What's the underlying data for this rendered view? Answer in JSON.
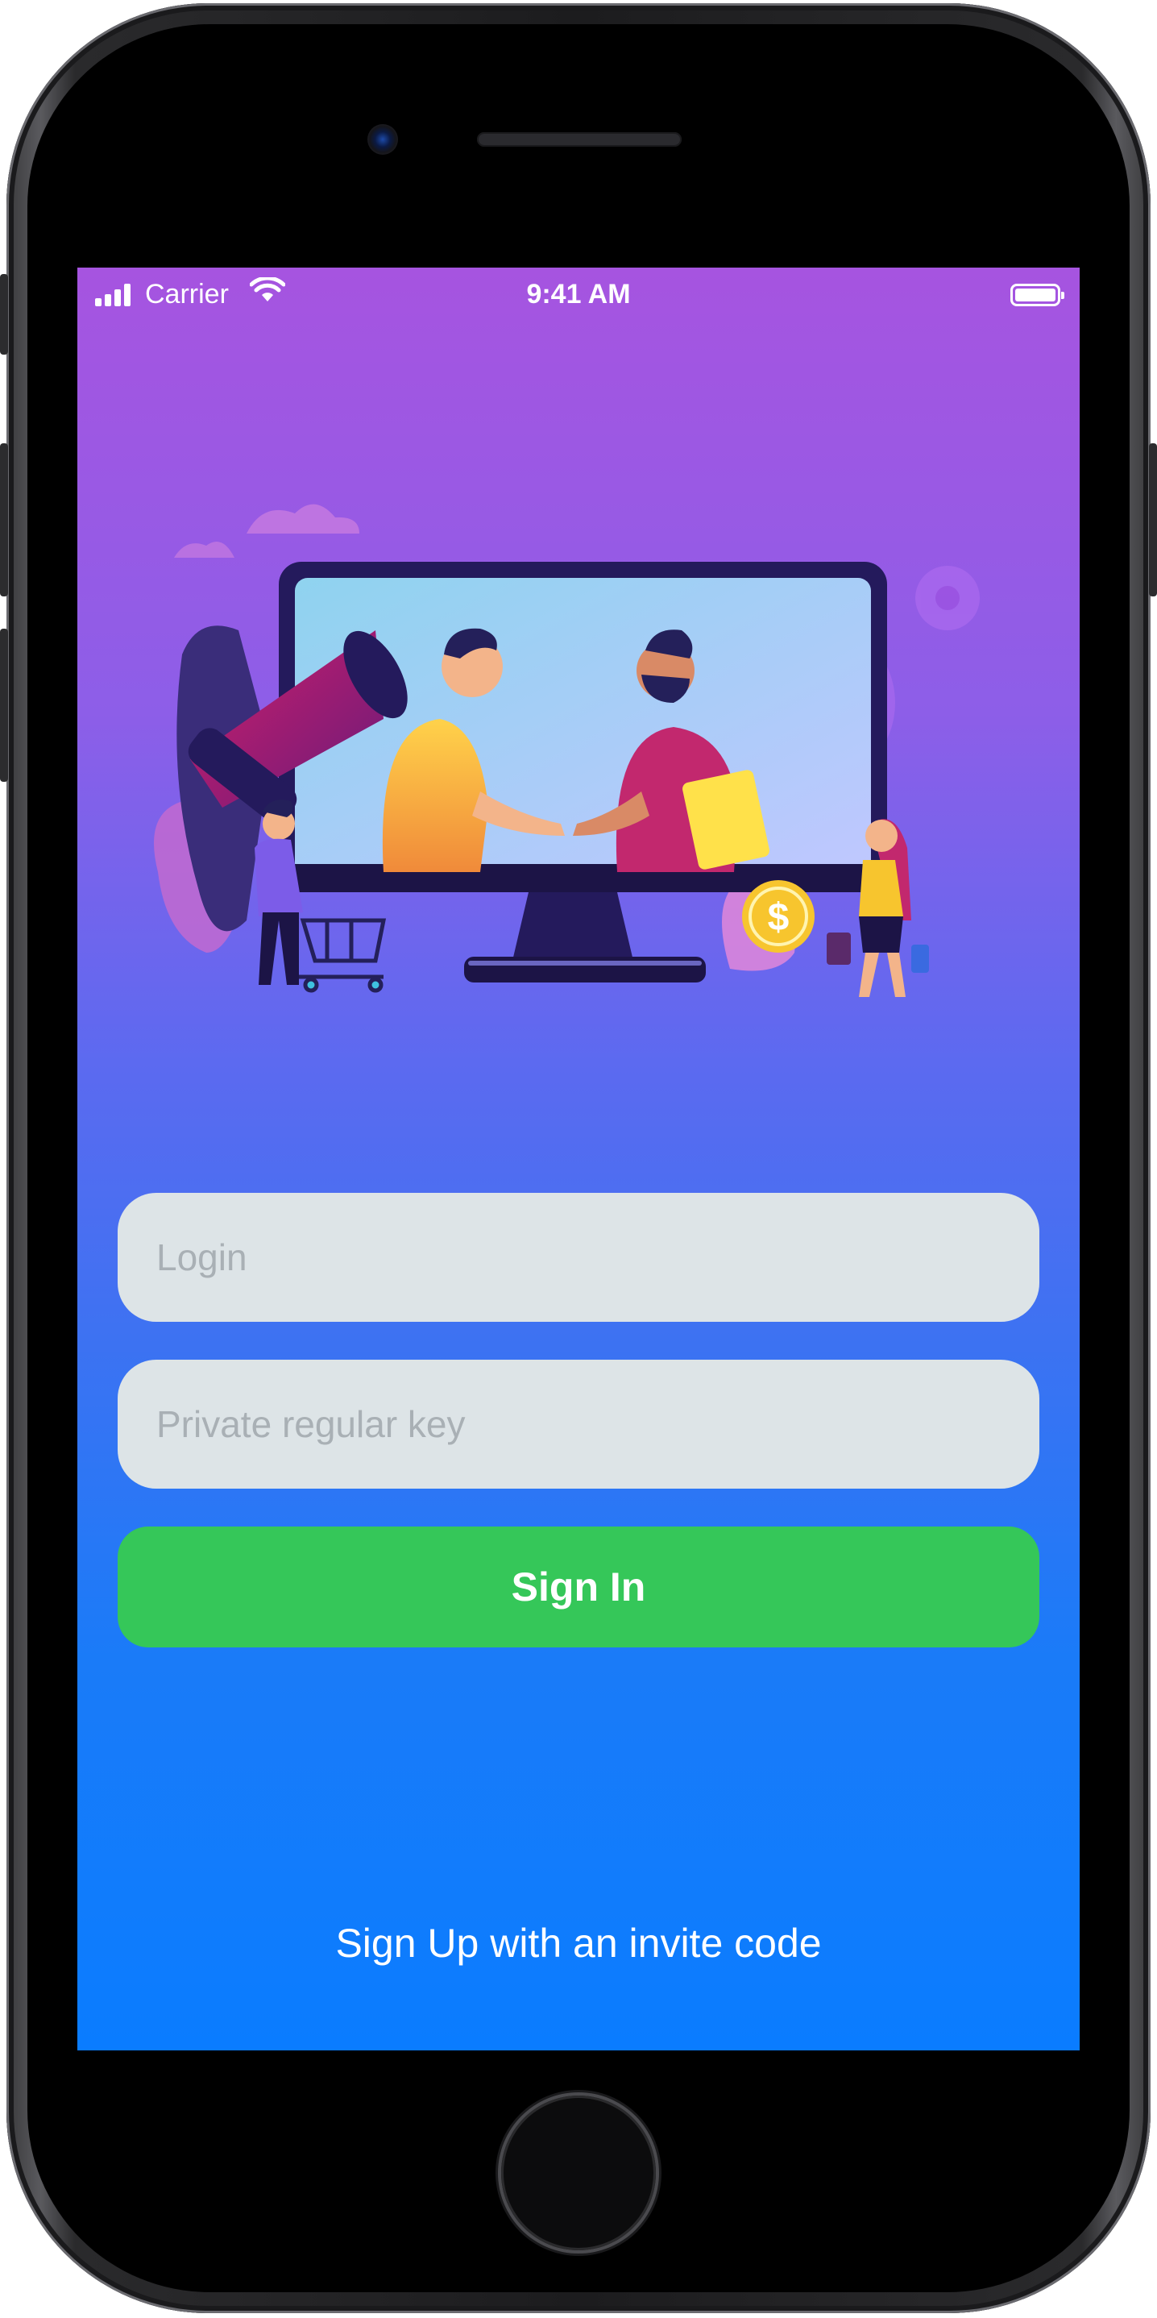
{
  "status_bar": {
    "carrier": "Carrier",
    "time": "9:41 AM"
  },
  "login_form": {
    "login_placeholder": "Login",
    "key_placeholder": "Private regular key",
    "sign_in_label": "Sign In",
    "sign_up_link": "Sign Up with an invite code"
  },
  "illustration": {
    "coin_symbol": "$"
  },
  "colors": {
    "gradient_top": "#a654e0",
    "gradient_bottom": "#0a7cff",
    "field_background": "#dde4e7",
    "sign_in_button": "#35c759",
    "placeholder_text": "#a9b0b5"
  },
  "icons": [
    "signal-icon",
    "wifi-icon",
    "battery-icon"
  ]
}
